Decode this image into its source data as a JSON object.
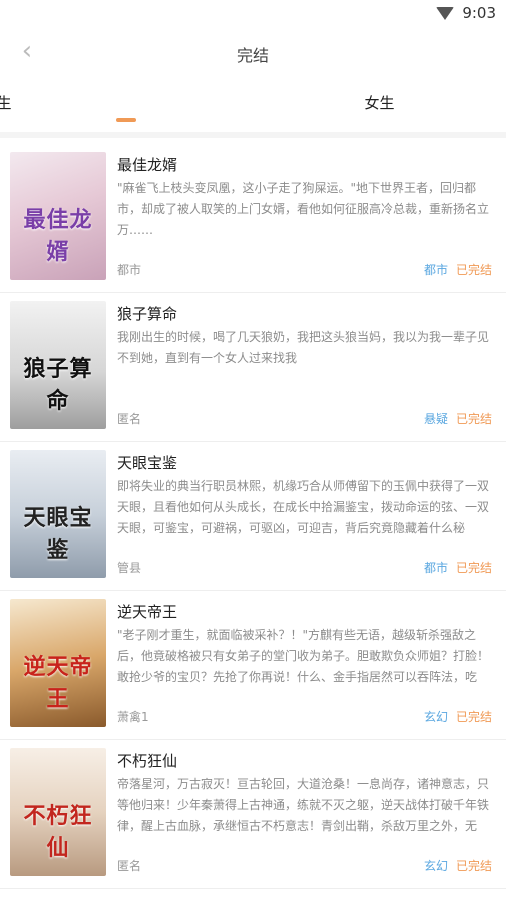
{
  "status_bar": {
    "time": "9:03"
  },
  "header": {
    "title": "完结"
  },
  "tabs": [
    {
      "label": "男生",
      "selected": true
    },
    {
      "label": "女生",
      "selected": false
    }
  ],
  "colors": {
    "accent": "#f09a56",
    "genre": "#5aa7e0"
  },
  "books": [
    {
      "title": "最佳龙婿",
      "description": "\"麻雀飞上枝头变凤凰，这小子走了狗屎运。\"地下世界王者，回归都市，却成了被人取笑的上门女婿，看他如何征服高冷总裁，重新扬名立万……",
      "author": "都市",
      "genre": "都市",
      "status": "已完结",
      "cover_text": "最佳龙婿"
    },
    {
      "title": "狼子算命",
      "description": "我刚出生的时候，喝了几天狼奶，我把这头狼当妈，我以为我一辈子见不到她，直到有一个女人过来找我",
      "author": "匿名",
      "genre": "悬疑",
      "status": "已完结",
      "cover_text": "狼子算命"
    },
    {
      "title": "天眼宝鉴",
      "description": "即将失业的典当行职员林熙，机缘巧合从师傅留下的玉佩中获得了一双天眼，且看他如何从头成长，在成长中拾漏鉴宝，拨动命运的弦、一双天眼，可鉴宝，可避祸，可驱凶，可迎吉，背后究竟隐藏着什么秘密……",
      "author": "管县",
      "genre": "都市",
      "status": "已完结",
      "cover_text": "天眼宝鉴"
    },
    {
      "title": "逆天帝王",
      "description": "\"老子刚才重生，就面临被采补？！\"方麒有些无语，越级斩杀强敌之后，他竟破格被只有女弟子的堂门收为弟子。胆敢欺负众师姐？打脸！敢抢少爷的宝贝？先抢了你再说！什么、金手指居然可以吞阵法，吃灵……",
      "author": "萧禽1",
      "genre": "玄幻",
      "status": "已完结",
      "cover_text": "逆天帝王"
    },
    {
      "title": "不朽狂仙",
      "description": "帝落星河，万古寂灭！亘古轮回，大道沧桑！一息尚存，诸神意志，只等他归来！少年秦萧得上古神通，练就不灭之躯，逆天战体打破千年铁律，醒上古血脉，承继恒古不朽意志！青剑出鞘，杀敌万里之外，无上……",
      "author": "匿名",
      "genre": "玄幻",
      "status": "已完结",
      "cover_text": "不朽狂仙"
    }
  ]
}
